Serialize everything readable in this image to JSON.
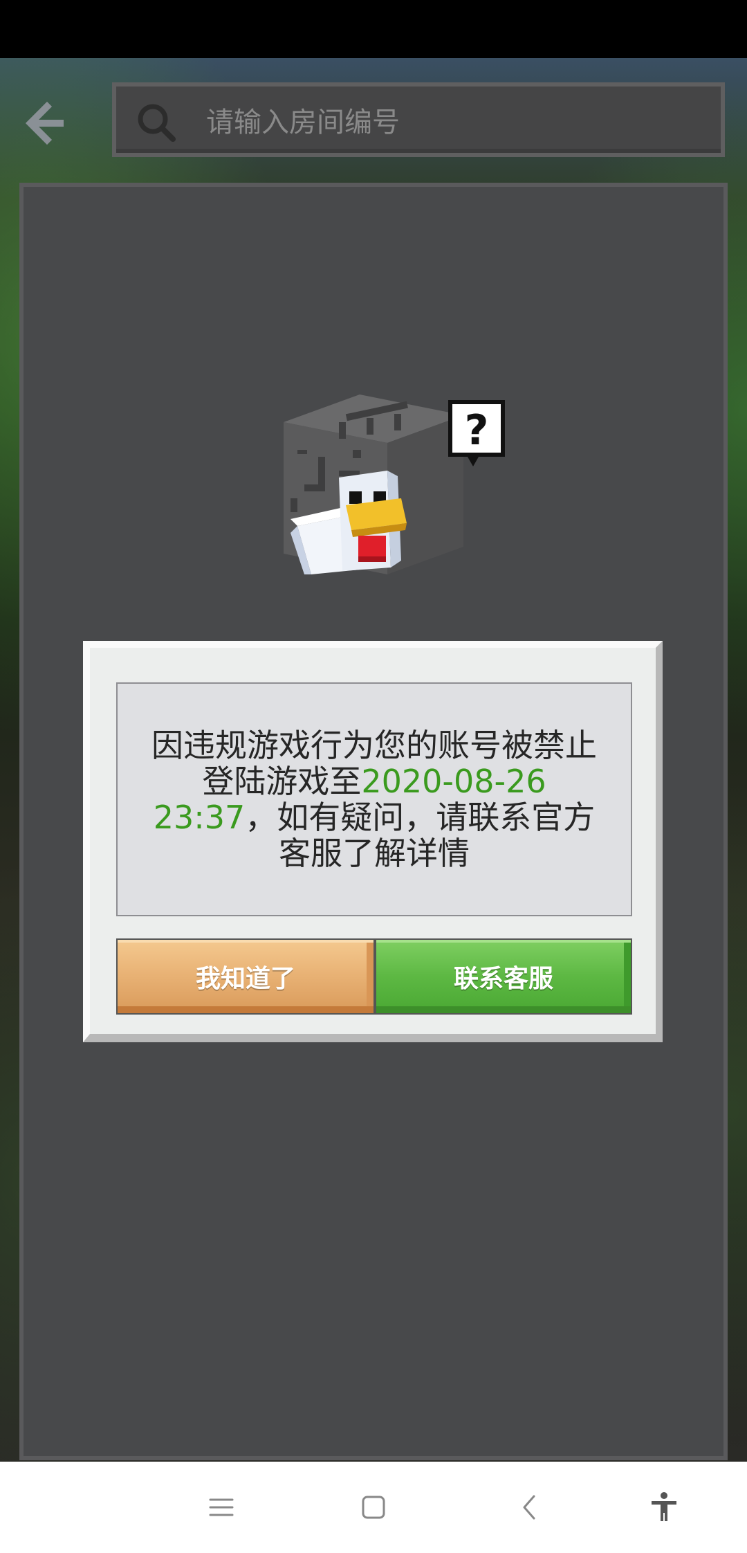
{
  "search": {
    "placeholder": "请输入房间编号"
  },
  "dialog": {
    "message_part1": "因违规游戏行为您的账号被禁止登陆游戏至",
    "ban_until": "2020-08-26 23:37",
    "message_part2": "，如有疑问，请联系官方客服了解详情",
    "ok_label": "我知道了",
    "contact_label": "联系客服"
  },
  "icons": {
    "back": "arrow-left-icon",
    "search": "search-icon",
    "illustration": "confused-chicken-ghast-icon",
    "nav_menu": "menu-icon",
    "nav_home": "home-square-icon",
    "nav_back": "chevron-left-icon",
    "nav_accessibility": "accessibility-icon"
  },
  "colors": {
    "highlight": "#3a9a1e",
    "ok_button": "#e9b376",
    "contact_button": "#5db843"
  }
}
